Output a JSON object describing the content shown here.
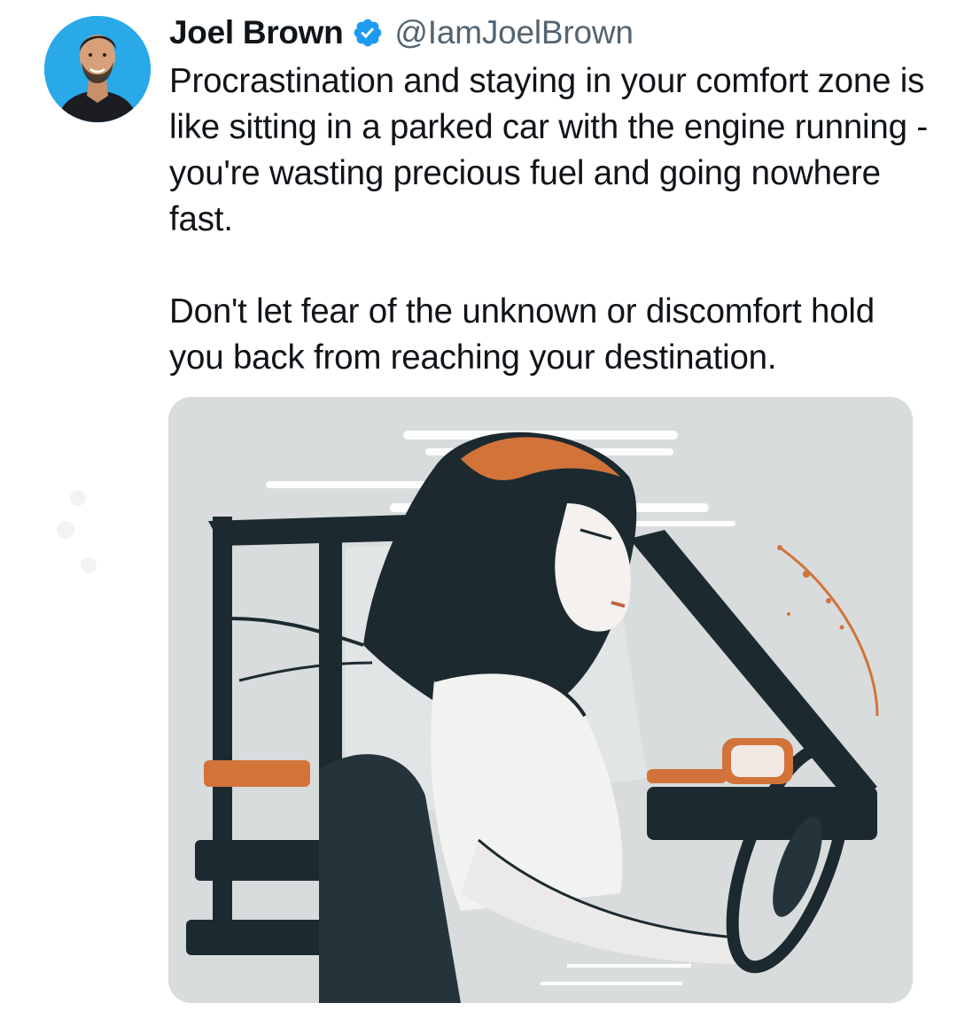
{
  "tweet": {
    "author": {
      "display_name": "Joel Brown",
      "handle": "@IamJoelBrown",
      "verified": true,
      "verified_icon": "verified-badge-icon",
      "verified_color": "#1d9bf0",
      "avatar_bg_color": "#29a9e8"
    },
    "text": {
      "paragraph_1": "Procrastination and staying in your comfort zone is like sitting in a parked car with the engine running - you're wasting precious fuel and going nowhere fast.",
      "paragraph_2": "Don't let fear of the unknown or discomfort hold you back from reaching your destination."
    },
    "media": {
      "type": "image"
    }
  },
  "colors": {
    "text_primary": "#0f1419",
    "text_secondary": "#536471",
    "accent_orange": "#d2733a",
    "ink_dark": "#1c2a30"
  }
}
